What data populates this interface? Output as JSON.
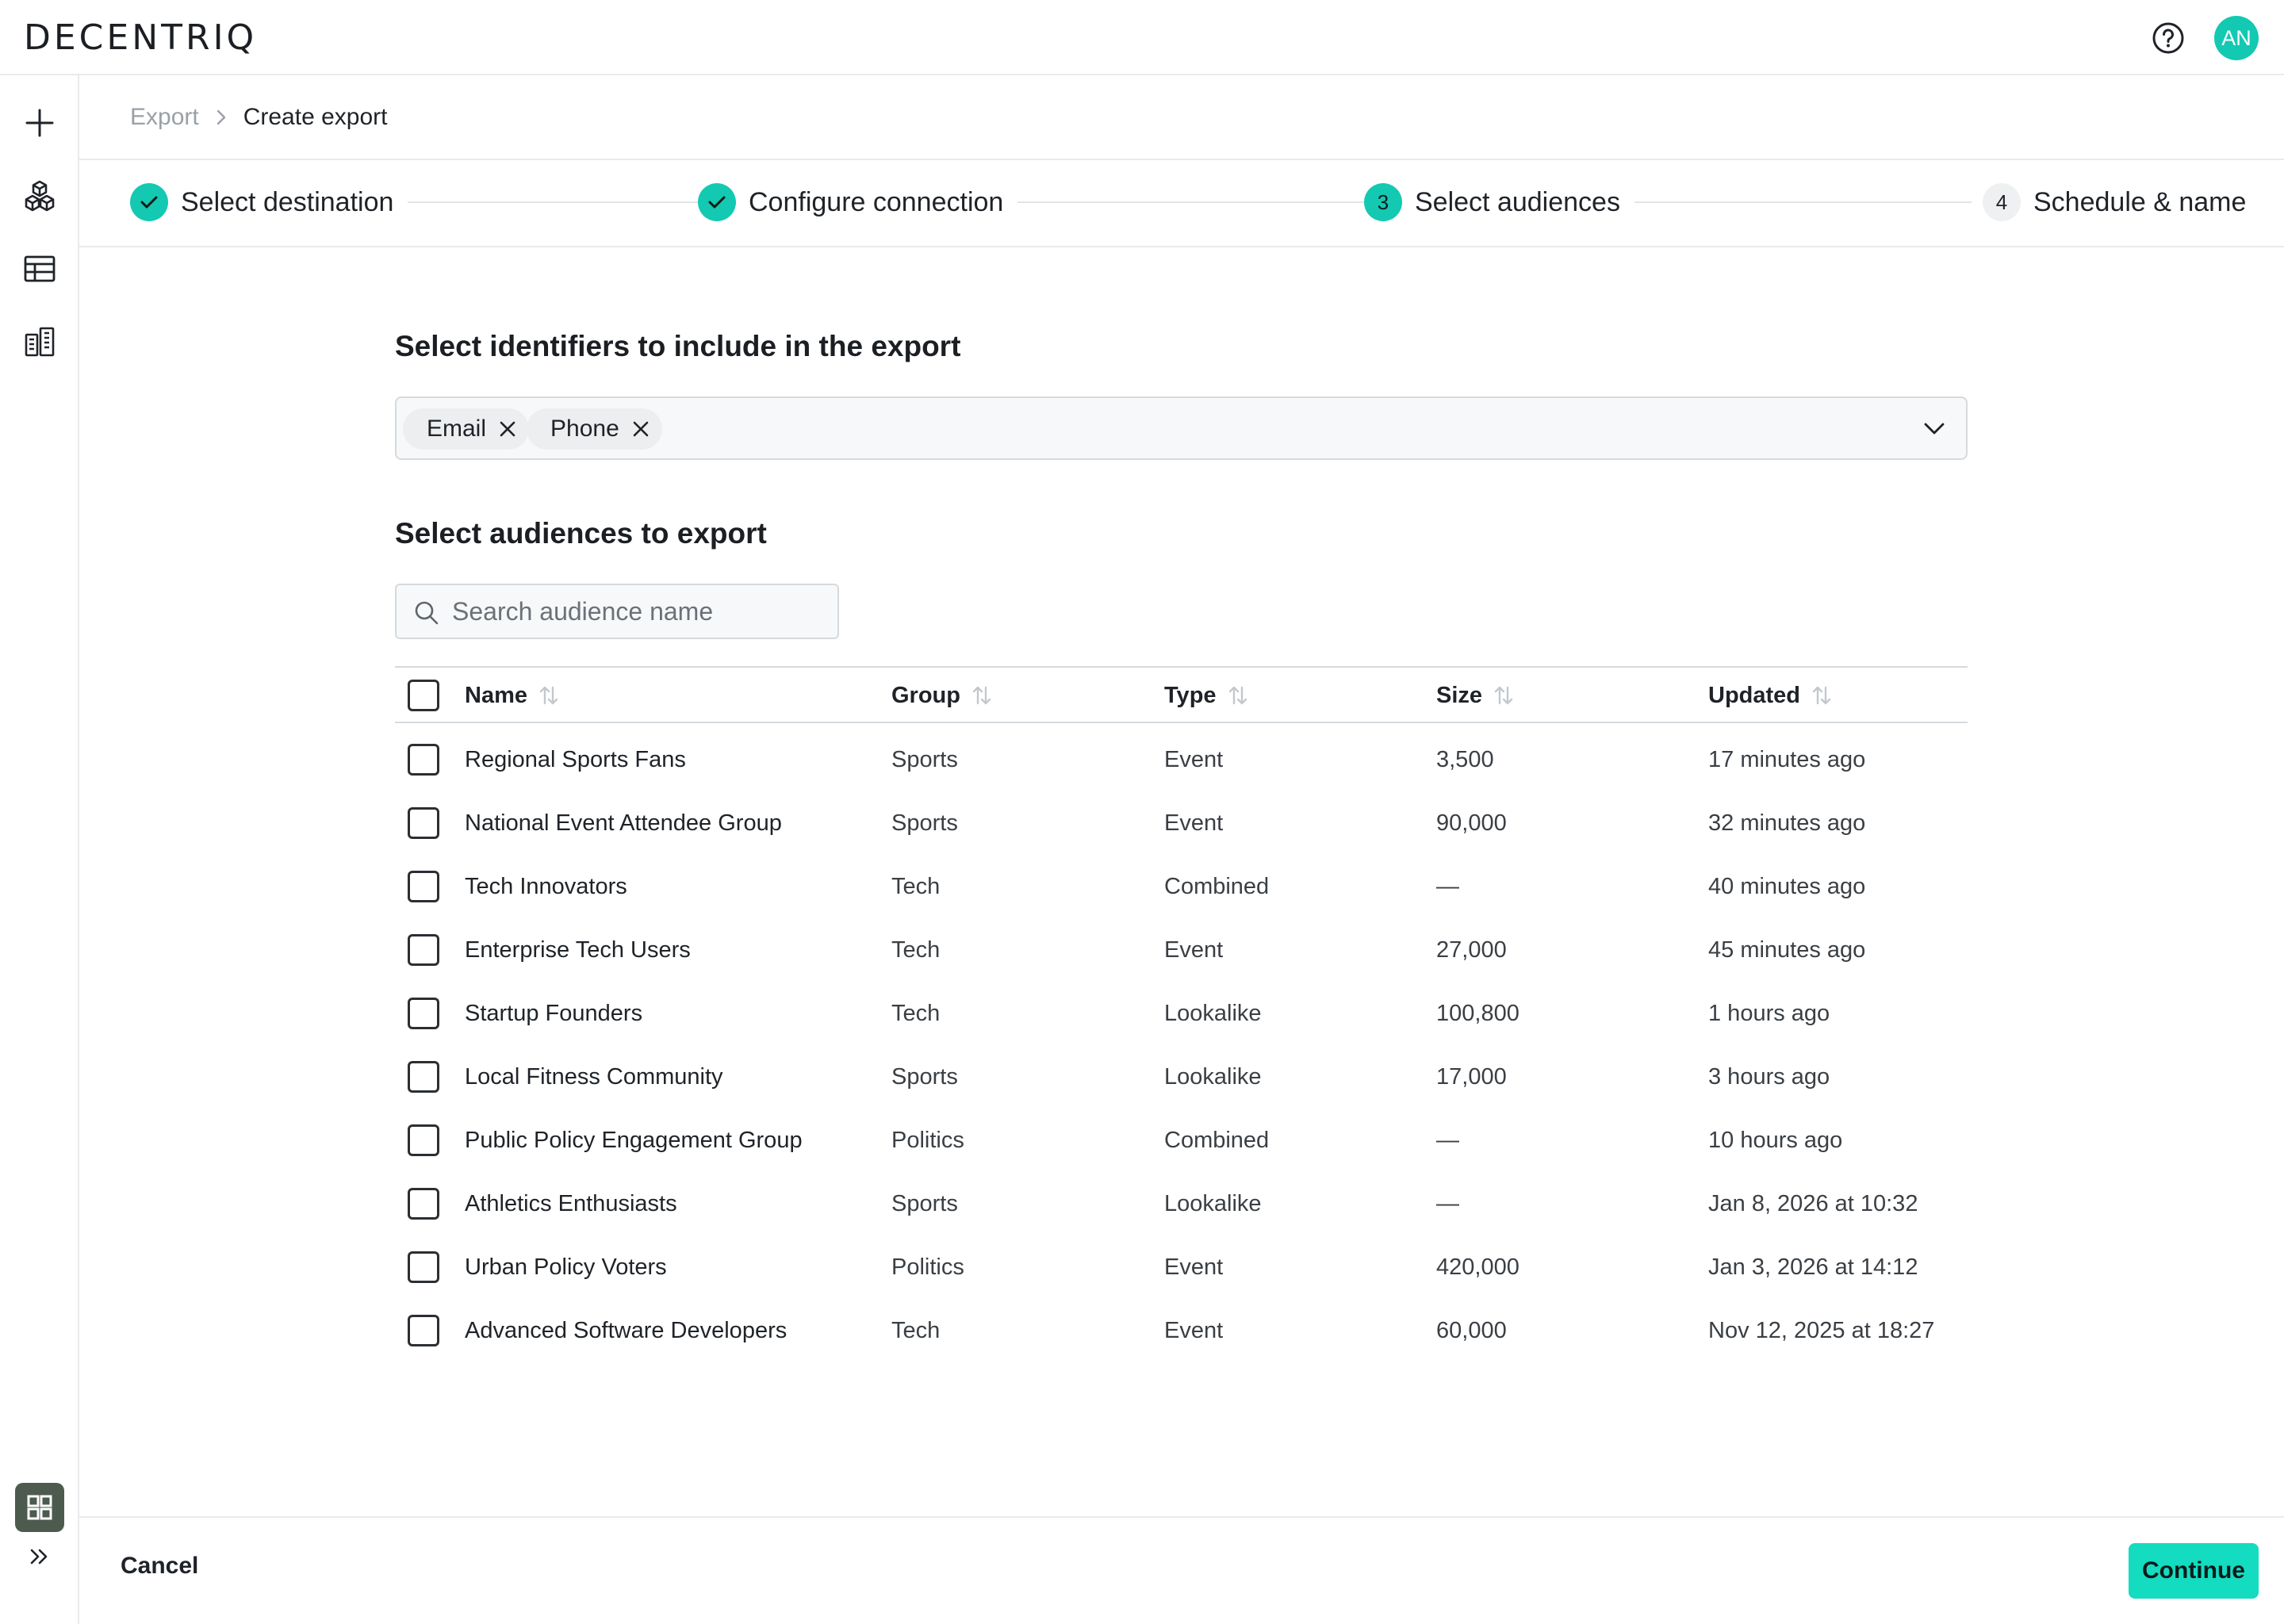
{
  "app": {
    "logo": "DECENTRIQ",
    "avatar_initials": "AN",
    "accent_color": "#13c9b2"
  },
  "topbar": {
    "help_icon": "help-circle-icon"
  },
  "sidebar": {
    "items": [
      {
        "icon": "plus-icon",
        "label": ""
      },
      {
        "icon": "cubes-icon",
        "label": ""
      },
      {
        "icon": "table-icon",
        "label": ""
      },
      {
        "icon": "buildings-icon",
        "label": ""
      }
    ],
    "app_icon": "apps-grid-icon",
    "expand_icon": "double-chevron-right-icon"
  },
  "breadcrumb": {
    "root": "Export",
    "current": "Create export"
  },
  "stepper": {
    "steps": [
      {
        "label": "Select destination",
        "status": "done",
        "badge": ""
      },
      {
        "label": "Configure connection",
        "status": "done",
        "badge": ""
      },
      {
        "label": "Select audiences",
        "status": "active",
        "badge": "3"
      },
      {
        "label": "Schedule & name",
        "status": "todo",
        "badge": "4"
      }
    ]
  },
  "identifiers": {
    "title": "Select identifiers to include in the export",
    "selected": [
      "Email",
      "Phone"
    ]
  },
  "audiences": {
    "title": "Select audiences to export",
    "search_placeholder": "Search audience name",
    "search_value": "",
    "columns": [
      "Name",
      "Group",
      "Type",
      "Size",
      "Updated"
    ],
    "rows": [
      {
        "name": "Regional Sports Fans",
        "group": "Sports",
        "type": "Event",
        "size": "3,500",
        "updated": "17 minutes ago"
      },
      {
        "name": "National Event Attendee Group",
        "group": "Sports",
        "type": "Event",
        "size": "90,000",
        "updated": "32 minutes ago"
      },
      {
        "name": "Tech Innovators",
        "group": "Tech",
        "type": "Combined",
        "size": "—",
        "updated": "40 minutes ago"
      },
      {
        "name": "Enterprise Tech Users",
        "group": "Tech",
        "type": "Event",
        "size": "27,000",
        "updated": "45 minutes ago"
      },
      {
        "name": "Startup Founders",
        "group": "Tech",
        "type": "Lookalike",
        "size": "100,800",
        "updated": "1 hours ago"
      },
      {
        "name": "Local Fitness Community",
        "group": "Sports",
        "type": "Lookalike",
        "size": "17,000",
        "updated": "3 hours ago"
      },
      {
        "name": "Public Policy Engagement Group",
        "group": "Politics",
        "type": "Combined",
        "size": "—",
        "updated": "10 hours ago"
      },
      {
        "name": "Athletics Enthusiasts",
        "group": "Sports",
        "type": "Lookalike",
        "size": "—",
        "updated": "Jan 8, 2026 at 10:32"
      },
      {
        "name": "Urban Policy Voters",
        "group": "Politics",
        "type": "Event",
        "size": "420,000",
        "updated": "Jan 3, 2026 at 14:12"
      },
      {
        "name": "Advanced Software Developers",
        "group": "Tech",
        "type": "Event",
        "size": "60,000",
        "updated": "Nov 12, 2025 at 18:27"
      }
    ]
  },
  "footer": {
    "cancel_label": "Cancel",
    "continue_label": "Continue"
  }
}
